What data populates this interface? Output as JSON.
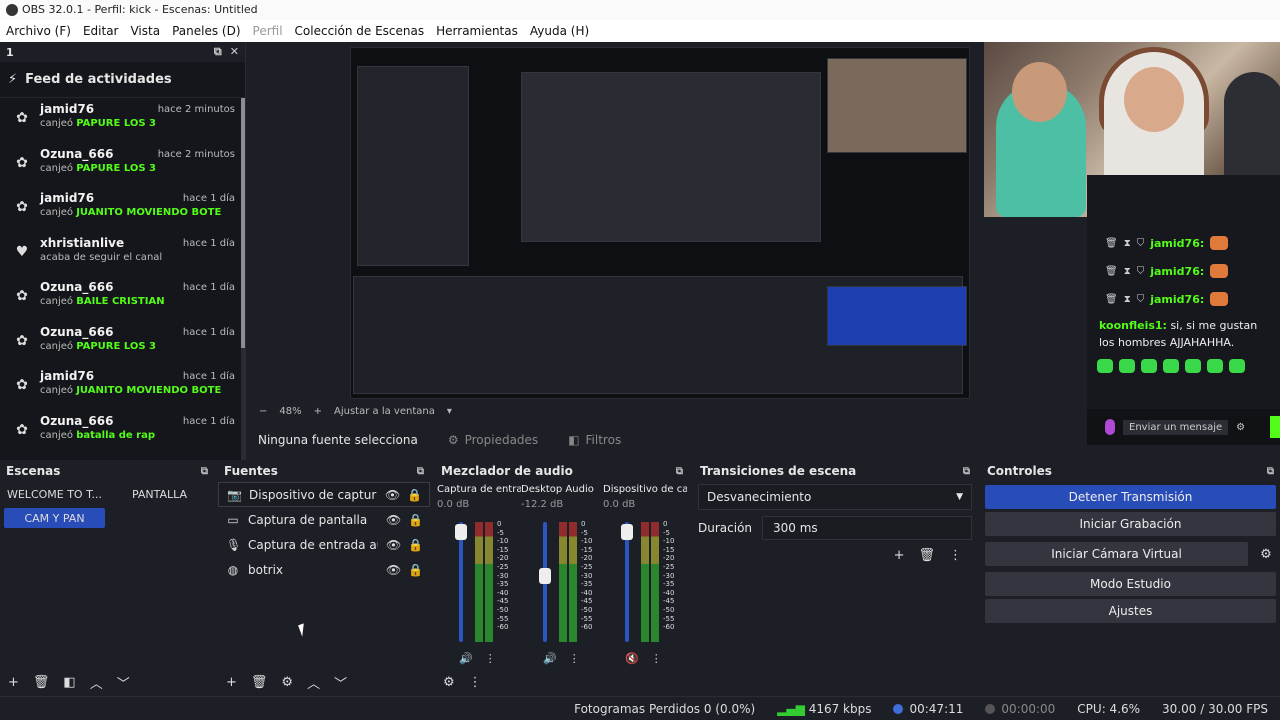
{
  "window": {
    "title": "OBS 32.0.1 - Perfil: kick - Escenas: Untitled"
  },
  "menu": [
    {
      "label": "Archivo (F)",
      "disabled": false
    },
    {
      "label": "Editar",
      "disabled": false
    },
    {
      "label": "Vista",
      "disabled": false
    },
    {
      "label": "Paneles (D)",
      "disabled": false
    },
    {
      "label": "Perfil",
      "disabled": true
    },
    {
      "label": "Colección de Escenas",
      "disabled": false
    },
    {
      "label": "Herramientas",
      "disabled": false
    },
    {
      "label": "Ayuda (H)",
      "disabled": false
    }
  ],
  "feed": {
    "dock_title": "1",
    "title": "Feed de actividades",
    "items": [
      {
        "name": "jamid76",
        "prefix": "canjeó",
        "highlight": "PAPURE LOS 3",
        "time": "hace 2 minutos",
        "icon": "gift"
      },
      {
        "name": "Ozuna_666",
        "prefix": "canjeó",
        "highlight": "PAPURE LOS 3",
        "time": "hace 2 minutos",
        "icon": "gift"
      },
      {
        "name": "jamid76",
        "prefix": "canjeó",
        "highlight": "JUANITO MOVIENDO BOTE",
        "time": "hace 1 día",
        "icon": "gift"
      },
      {
        "name": "xhristianlive",
        "prefix": "acaba de seguir el canal",
        "highlight": "",
        "time": "hace 1 día",
        "icon": "heart"
      },
      {
        "name": "Ozuna_666",
        "prefix": "canjeó",
        "highlight": "BAILE CRISTIAN",
        "time": "hace 1 día",
        "icon": "gift"
      },
      {
        "name": "Ozuna_666",
        "prefix": "canjeó",
        "highlight": "PAPURE LOS 3",
        "time": "hace 1 día",
        "icon": "gift"
      },
      {
        "name": "jamid76",
        "prefix": "canjeó",
        "highlight": "JUANITO MOVIENDO BOTE",
        "time": "hace 1 día",
        "icon": "gift"
      },
      {
        "name": "Ozuna_666",
        "prefix": "canjeó",
        "highlight": "batalla de rap",
        "time": "hace 1 día",
        "icon": "gift"
      }
    ]
  },
  "chat": {
    "lines": [
      {
        "user": "jamid76:"
      },
      {
        "user": "jamid76:"
      },
      {
        "user": "jamid76:"
      }
    ],
    "message_user": "koonfleis1:",
    "message_text": "si, si me gustan los hombres AJJAHAHHA.",
    "input_placeholder": "Enviar un mensaje"
  },
  "preview": {
    "zoom": "48%",
    "fit_label": "Ajustar a la ventana"
  },
  "sourcebar": {
    "no_source": "Ninguna fuente selecciona",
    "properties": "Propiedades",
    "filters": "Filtros"
  },
  "scenes": {
    "title": "Escenas",
    "items": [
      {
        "label": "WELCOME TO T...",
        "active": false
      },
      {
        "label": "PANTALLA",
        "active": false
      },
      {
        "label": "CAM Y PAN",
        "active": true
      }
    ]
  },
  "sources": {
    "title": "Fuentes",
    "items": [
      {
        "label": "Dispositivo de captura de v",
        "icon": "camera-icon",
        "selected": true
      },
      {
        "label": "Captura de pantalla",
        "icon": "monitor-icon",
        "selected": false
      },
      {
        "label": "Captura de entrada audio",
        "icon": "microphone-icon",
        "selected": false
      },
      {
        "label": "botrix",
        "icon": "globe-icon",
        "selected": false
      }
    ]
  },
  "mixer": {
    "title": "Mezclador de audio",
    "channels": [
      {
        "name": "Captura de entrada",
        "db": "0.0 dB",
        "level": 0.92,
        "muted": false
      },
      {
        "name": "Desktop Audio",
        "db": "-12.2 dB",
        "level": 0.55,
        "muted": false
      },
      {
        "name": "Dispositivo de capt",
        "db": "0.0 dB",
        "level": 0.92,
        "muted": true
      }
    ],
    "scale": [
      "0",
      "-5",
      "-10",
      "-15",
      "-20",
      "-25",
      "-30",
      "-35",
      "-40",
      "-45",
      "-50",
      "-55",
      "-60"
    ]
  },
  "transitions": {
    "title": "Transiciones de escena",
    "selected": "Desvanecimiento",
    "duration_label": "Duración",
    "duration_value": "300 ms"
  },
  "controls": {
    "title": "Controles",
    "buttons": {
      "stop_stream": "Detener Transmisión",
      "start_record": "Iniciar Grabación",
      "virtual_cam": "Iniciar Cámara Virtual",
      "studio_mode": "Modo Estudio",
      "settings": "Ajustes"
    }
  },
  "status": {
    "dropped": "Fotogramas Perdidos 0 (0.0%)",
    "bitrate": "4167 kbps",
    "stream_time": "00:47:11",
    "record_time": "00:00:00",
    "cpu": "CPU: 4.6%",
    "fps": "30.00 / 30.00 FPS"
  }
}
